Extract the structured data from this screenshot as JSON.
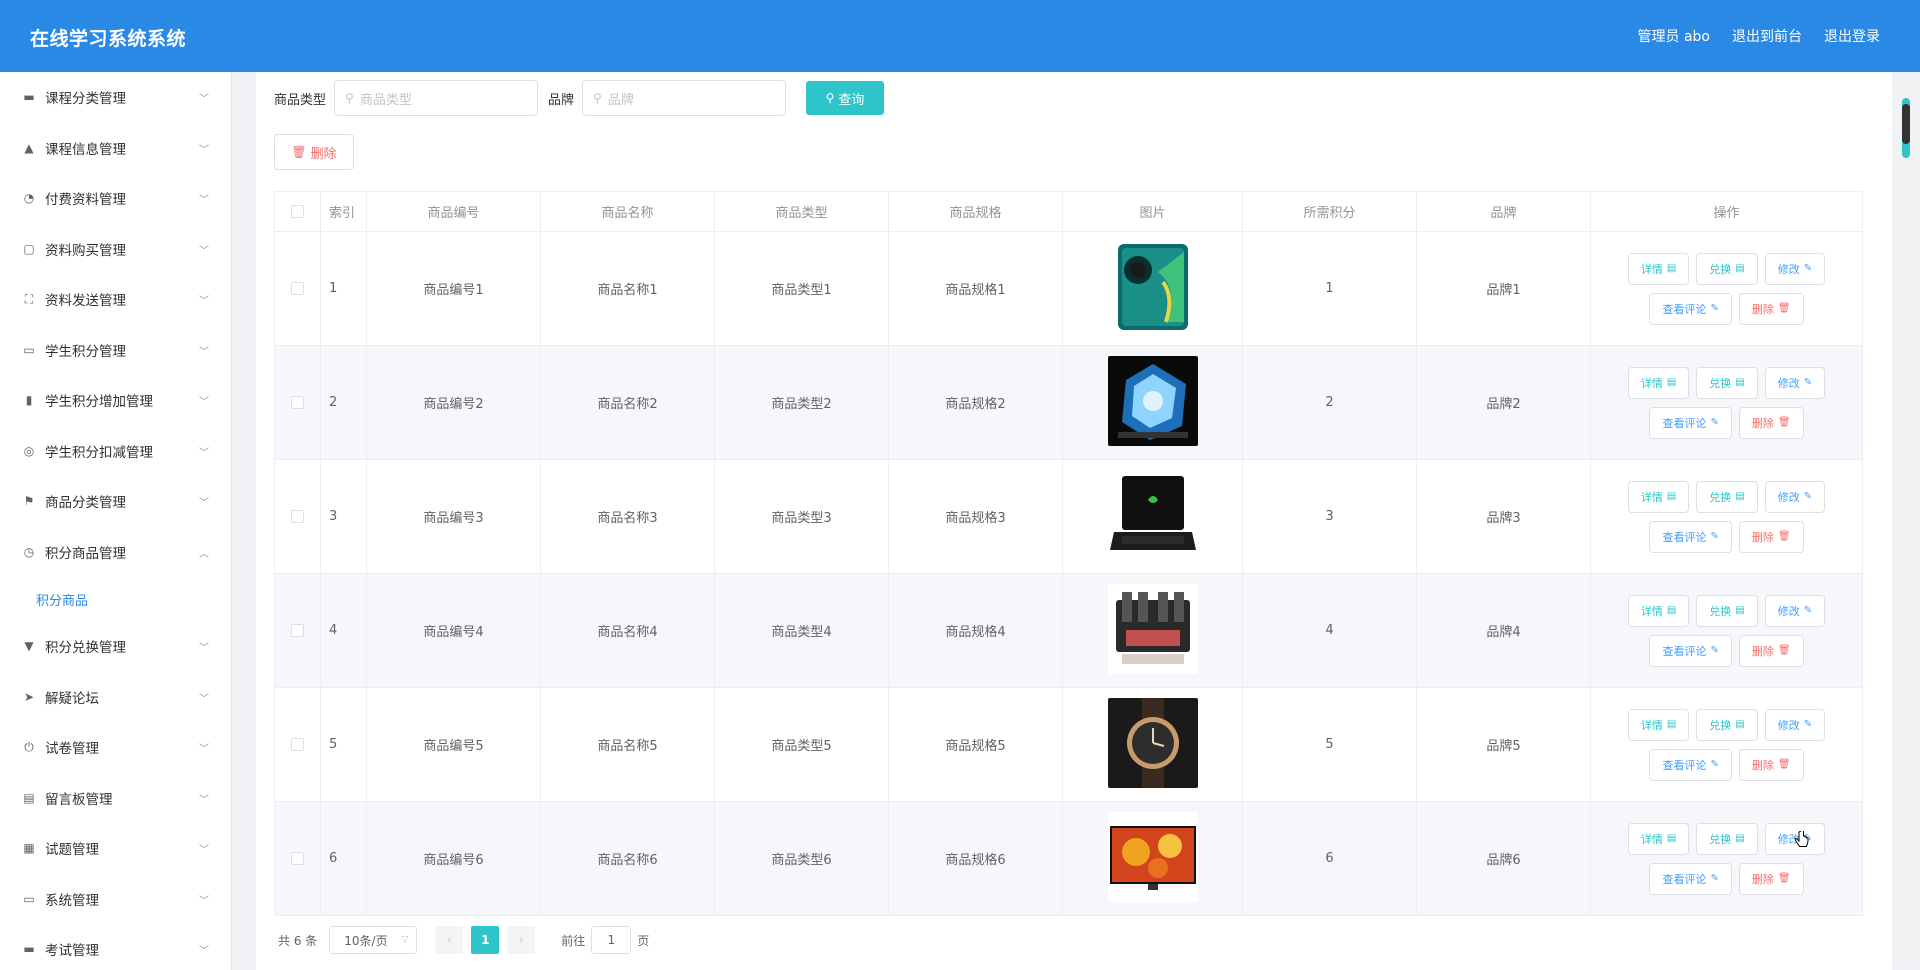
{
  "header": {
    "brand": "在线学习系统系统",
    "admin": "管理员 abo",
    "to_front": "退出到前台",
    "logout": "退出登录"
  },
  "sidebar": {
    "items": [
      {
        "label": "课程分类管理",
        "icon": "chat-icon"
      },
      {
        "label": "课程信息管理",
        "icon": "thumb-icon"
      },
      {
        "label": "付费资料管理",
        "icon": "dashboard-icon"
      },
      {
        "label": "资料购买管理",
        "icon": "copy-icon"
      },
      {
        "label": "资料发送管理",
        "icon": "fullscreen-icon"
      },
      {
        "label": "学生积分管理",
        "icon": "picture-icon"
      },
      {
        "label": "学生积分增加管理",
        "icon": "mic-icon"
      },
      {
        "label": "学生积分扣减管理",
        "icon": "football-icon"
      },
      {
        "label": "商品分类管理",
        "icon": "flag-icon"
      },
      {
        "label": "积分商品管理",
        "icon": "compass-icon",
        "expanded": true
      }
    ],
    "sub_item": "积分商品",
    "items_after": [
      {
        "label": "积分兑换管理",
        "icon": "stamp-icon"
      },
      {
        "label": "解疑论坛",
        "icon": "send-icon"
      },
      {
        "label": "试卷管理",
        "icon": "power-icon"
      },
      {
        "label": "留言板管理",
        "icon": "checklist-icon"
      },
      {
        "label": "试题管理",
        "icon": "grid-icon"
      },
      {
        "label": "系统管理",
        "icon": "message-icon"
      },
      {
        "label": "考试管理",
        "icon": "bus-icon"
      }
    ]
  },
  "search": {
    "type_label": "商品类型",
    "type_placeholder": "商品类型",
    "brand_label": "品牌",
    "brand_placeholder": "品牌",
    "query_button": "查询"
  },
  "toolbar": {
    "delete_button": "删除"
  },
  "table": {
    "headers": [
      "索引",
      "商品编号",
      "商品名称",
      "商品类型",
      "商品规格",
      "图片",
      "所需积分",
      "品牌",
      "操作"
    ],
    "rows": [
      {
        "index": "1",
        "code": "商品编号1",
        "name": "商品名称1",
        "type": "商品类型1",
        "spec": "商品规格1",
        "image": "phone",
        "points": "1",
        "brand": "品牌1"
      },
      {
        "index": "2",
        "code": "商品编号2",
        "name": "商品名称2",
        "type": "商品类型2",
        "spec": "商品规格2",
        "image": "pc-case",
        "points": "2",
        "brand": "品牌2"
      },
      {
        "index": "3",
        "code": "商品编号3",
        "name": "商品名称3",
        "type": "商品类型3",
        "spec": "商品规格3",
        "image": "laptop",
        "points": "3",
        "brand": "品牌3"
      },
      {
        "index": "4",
        "code": "商品编号4",
        "name": "商品名称4",
        "type": "商品类型4",
        "spec": "商品规格4",
        "image": "amplifier",
        "points": "4",
        "brand": "品牌4"
      },
      {
        "index": "5",
        "code": "商品编号5",
        "name": "商品名称5",
        "type": "商品类型5",
        "spec": "商品规格5",
        "image": "watch",
        "points": "5",
        "brand": "品牌5"
      },
      {
        "index": "6",
        "code": "商品编号6",
        "name": "商品名称6",
        "type": "商品类型6",
        "spec": "商品规格6",
        "image": "tv",
        "points": "6",
        "brand": "品牌6"
      }
    ],
    "actions": {
      "detail": "详情",
      "exchange": "兑换",
      "edit": "修改",
      "comments": "查看评论",
      "delete": "删除"
    }
  },
  "pagination": {
    "total": "共 6 条",
    "page_size": "10条/页",
    "current_page": "1",
    "goto_label": "前往",
    "goto_value": "1",
    "page_suffix": "页"
  },
  "colors": {
    "header": "#2a89e4",
    "accent": "#2ec4c9",
    "danger": "#f56c6c"
  }
}
